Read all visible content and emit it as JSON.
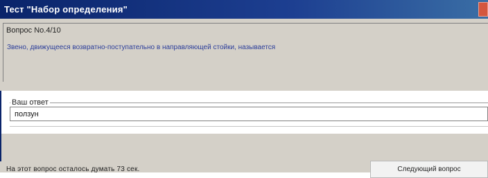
{
  "window": {
    "title": "Тест \"Набор определения\""
  },
  "question": {
    "legend": "Вопрос No.4/10",
    "text": "Звено, движущееся возвратно-поступательно в направляющей стойки, называется"
  },
  "answer": {
    "legend": "Ваш ответ",
    "value": "ползун"
  },
  "status": {
    "text": "На этот вопрос осталось думать 73 сек."
  },
  "buttons": {
    "next_label": "Следующий вопрос"
  },
  "colors": {
    "titlebar": "#0a246a",
    "question_text": "#2c3e9a",
    "window_bg": "#d4d0c8"
  }
}
